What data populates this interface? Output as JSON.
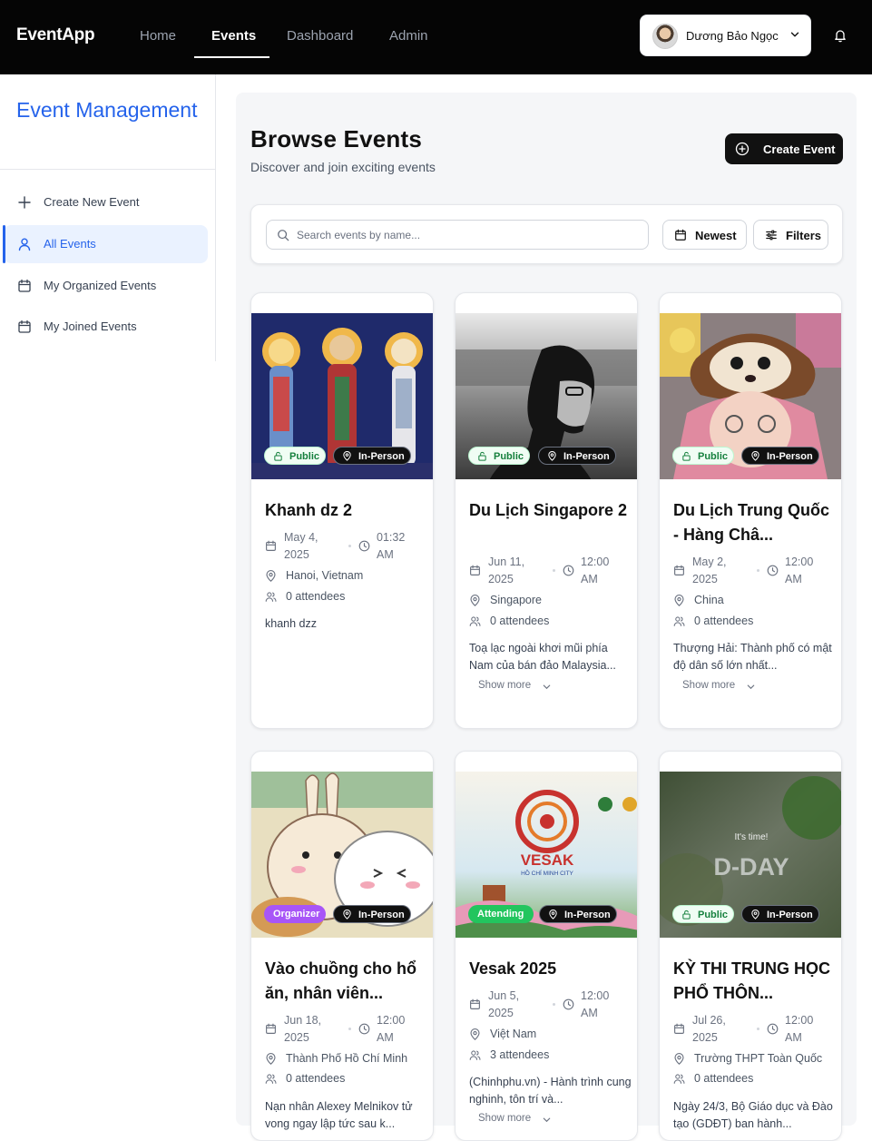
{
  "nav": {
    "brand": "EventApp",
    "links": [
      "Home",
      "Events",
      "Dashboard",
      "Admin"
    ],
    "active": "Events",
    "user_name": "Dương Bảo Ngọc"
  },
  "sidebar": {
    "title": "Event Management",
    "items": [
      {
        "label": "Create New Event",
        "icon": "plus-icon"
      },
      {
        "label": "All Events",
        "icon": "user-icon",
        "active": true
      },
      {
        "label": "My Organized Events",
        "icon": "calendar-icon"
      },
      {
        "label": "My Joined Events",
        "icon": "calendar-icon"
      }
    ]
  },
  "page": {
    "title": "Browse Events",
    "subtitle": "Discover and join exciting events",
    "create_label": "Create Event"
  },
  "filters": {
    "search_placeholder": "Search events by name...",
    "sort_label": "Newest",
    "filters_label": "Filters"
  },
  "colors": {
    "accent": "#2563eb",
    "public_badge": "#15803d",
    "organizer_badge": "#a855f7",
    "attending_badge": "#22c55e"
  },
  "events": [
    {
      "title": "Khanh dz 2",
      "badge": "Public",
      "mode": "In-Person",
      "date": "May 4, 2025",
      "time": "01:32 AM",
      "location": "Hanoi, Vietnam",
      "attendees": "0 attendees",
      "description": "khanh dzz",
      "show_more": ""
    },
    {
      "title": "Du Lịch Singapore 2",
      "badge": "Public",
      "mode": "In-Person",
      "date": "Jun 11, 2025",
      "time": "12:00 AM",
      "location": "Singapore",
      "attendees": "0 attendees",
      "description": "Toạ lạc ngoài khơi mũi phía Nam của bán đảo Malaysia...",
      "show_more": "Show more"
    },
    {
      "title": "Du Lịch Trung Quốc - Hàng Châ...",
      "badge": "Public",
      "mode": "In-Person",
      "date": "May 2, 2025",
      "time": "12:00 AM",
      "location": "China",
      "attendees": "0 attendees",
      "description": "Thượng Hải: Thành phố có mật độ dân số lớn nhất...",
      "show_more": "Show more"
    },
    {
      "title": "Vào chuồng cho hổ ăn, nhân viên...",
      "badge": "Organizer",
      "mode": "In-Person",
      "date": "Jun 18, 2025",
      "time": "12:00 AM",
      "location": "Thành Phố Hồ Chí Minh",
      "attendees": "0 attendees",
      "description": "Nạn nhân Alexey Melnikov tử vong ngay lập tức sau k...",
      "show_more": ""
    },
    {
      "title": "Vesak 2025",
      "badge": "Attending",
      "mode": "In-Person",
      "date": "Jun 5, 2025",
      "time": "12:00 AM",
      "location": "Việt Nam",
      "attendees": "3 attendees",
      "description": "(Chinhphu.vn) - Hành trình cung nghinh, tôn trí và...",
      "show_more": "Show more"
    },
    {
      "title": "KỲ THI TRUNG HỌC PHỔ THÔN...",
      "badge": "Public",
      "mode": "In-Person",
      "date": "Jul 26, 2025",
      "time": "12:00 AM",
      "location": "Trường THPT Toàn Quốc",
      "attendees": "0 attendees",
      "description": "Ngày 24/3, Bộ Giáo dục và Đào tạo (GDĐT) ban hành...",
      "show_more": ""
    }
  ],
  "image_text": {
    "vesak_title": "VESAK",
    "vesak_city": "HỒ CHÍ MINH CITY",
    "dday_small": "It's time!",
    "dday_big": "D-DAY"
  }
}
